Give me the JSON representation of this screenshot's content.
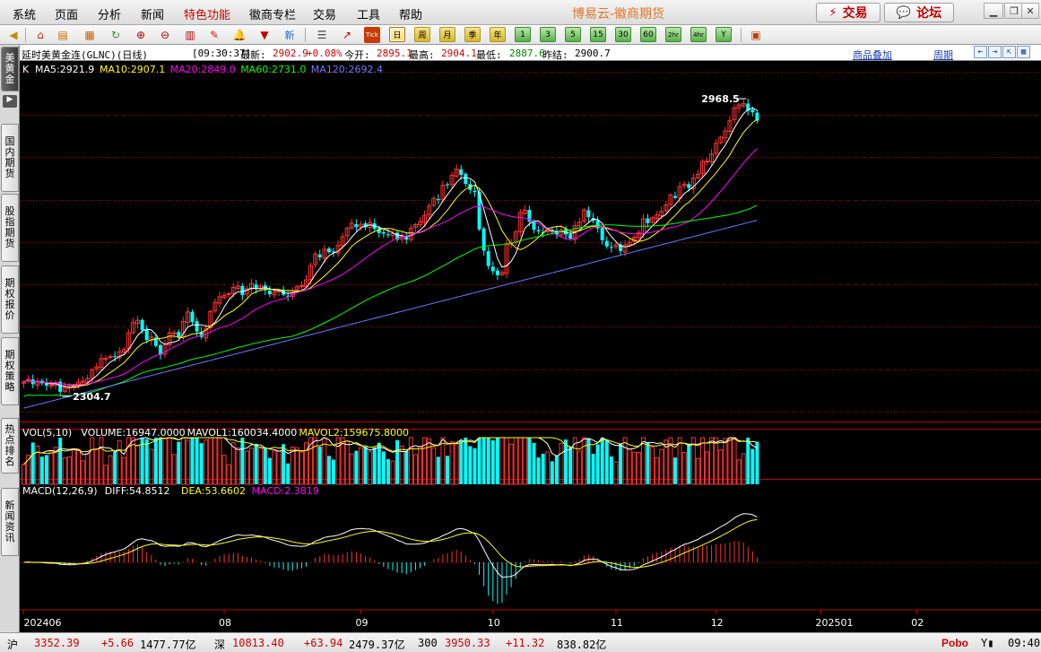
{
  "menu": {
    "items": [
      "系统",
      "页面",
      "分析",
      "新闻",
      "特色功能",
      "徽商专栏",
      "交易",
      "工具",
      "帮助"
    ],
    "app_title": "博易云-徽商期货",
    "trade_button": "交易",
    "forum_button": "论坛"
  },
  "toolbar": {
    "periods": [
      "日",
      "周",
      "月",
      "季",
      "年",
      "1",
      "3",
      "5",
      "15",
      "30",
      "60",
      "2hr",
      "4hr",
      "Y"
    ],
    "active_period": "日"
  },
  "sidebar": {
    "tabs": [
      "美黄金",
      "国内期货",
      "股指期货",
      "期权报价",
      "期权策略",
      "热点排名",
      "新闻资讯"
    ]
  },
  "quote": {
    "time": "[09:30:37]",
    "last_label": "最新:",
    "last": "2902.9",
    "change": "+0.08%",
    "open_label": "今开:",
    "open": "2895.1",
    "high_label": "最高:",
    "high": "2904.1",
    "low_label": "最低:",
    "low": "2887.6",
    "prev_label": "昨结:",
    "prev_close": "2900.7",
    "overlay_link": "商品叠加",
    "cycle_link": "周期"
  },
  "chart_data": {
    "type": "candlestick",
    "title": "延时美黄金连(GLNC)(日线)",
    "price_pane": {
      "indicator_prefix": "K",
      "ma_labels": [
        {
          "text": "MA5:2921.9",
          "color": "#ffffff"
        },
        {
          "text": "MA10:2907.1",
          "color": "#ffff00"
        },
        {
          "text": "MA20:2849.0",
          "color": "#ff00ff"
        },
        {
          "text": "MA60:2731.0",
          "color": "#00ff00"
        },
        {
          "text": "MA120:2692.4",
          "color": "#6b7bff"
        }
      ],
      "high_marker": "2968.5",
      "low_marker": "2304.7",
      "ylim": [
        2240,
        3010
      ],
      "x_ticks": [
        "202406",
        "08",
        "09",
        "10",
        "11",
        "12",
        "202501",
        "02"
      ],
      "x_tick_days": [
        0,
        44,
        74,
        103,
        130,
        152,
        175,
        196
      ],
      "closes": [
        2332.6,
        2338.1,
        2327.5,
        2333.9,
        2329.3,
        2324.2,
        2326.1,
        2330.7,
        2310.8,
        2320.3,
        2319.9,
        2324.1,
        2332.0,
        2334.1,
        2339.8,
        2359.1,
        2365.4,
        2383.5,
        2383.8,
        2387.9,
        2387.3,
        2398.4,
        2403.1,
        2439.6,
        2462.0,
        2467.1,
        2445.8,
        2423.7,
        2430.6,
        2411.2,
        2391.7,
        2414.9,
        2439.7,
        2439.5,
        2430.8,
        2464.5,
        2485.3,
        2462.9,
        2442.5,
        2430.5,
        2449.3,
        2486.1,
        2506.2,
        2518.5,
        2521.2,
        2525.0,
        2538.9,
        2542.1,
        2522.2,
        2535.8,
        2547.2,
        2535.3,
        2541.7,
        2532.8,
        2524.0,
        2528.3,
        2532.6,
        2522.9,
        2519.8,
        2531.9,
        2540.4,
        2542.6,
        2555.3,
        2586.7,
        2611.8,
        2604.4,
        2622.1,
        2616.0,
        2615.7,
        2630.5,
        2649.5,
        2668.4,
        2679.1,
        2671.1,
        2676.7,
        2670.0,
        2680.6,
        2666.8,
        2657.6,
        2656.4,
        2653.3,
        2656.3,
        2643.5,
        2650.9,
        2643.4,
        2668.2,
        2675.9,
        2682.7,
        2696.3,
        2716.3,
        2733.4,
        2731.5,
        2762.1,
        2762.8,
        2784.0,
        2797.3,
        2784.8,
        2765.0,
        2752.0,
        2747.1,
        2665.6,
        2619.1,
        2585.7,
        2574.2,
        2565.4,
        2571.4,
        2632.9,
        2634.9,
        2660.1,
        2702.6,
        2707.8,
        2682.6,
        2665.0,
        2661.4,
        2658.8,
        2662.8,
        2664.1,
        2654.2,
        2664.7,
        2654.4,
        2645.6,
        2673.7,
        2681.7,
        2708.1,
        2692.8,
        2684.1,
        2667.8,
        2642.0,
        2628.4,
        2626.0,
        2632.0,
        2618.4,
        2632.1,
        2637.4,
        2648.0,
        2658.0,
        2688.8,
        2679.5,
        2691.0,
        2697.3,
        2704.8,
        2718.9,
        2740.6,
        2734.6,
        2759.0,
        2764.5,
        2756.2,
        2777.5,
        2785.3,
        2813.8,
        2814.8,
        2830.4,
        2853.7,
        2867.2,
        2880.6,
        2902.9,
        2930.8,
        2937.4,
        2940.2,
        2925.1,
        2921.6,
        2902.9
      ]
    },
    "volume_pane": {
      "labels": [
        {
          "text": "VOL(5,10)",
          "color": "#ffffff"
        },
        {
          "text": "VOLUME:16947.0000",
          "color": "#ffffff"
        },
        {
          "text": "MAVOL1:160034.4000",
          "color": "#ffffff"
        },
        {
          "text": "MAVOL2:159675.8000",
          "color": "#ffff00"
        }
      ]
    },
    "macd_pane": {
      "labels": [
        {
          "text": "MACD(12,26,9)",
          "color": "#ffffff"
        },
        {
          "text": "DIFF:54.8512",
          "color": "#ffffff"
        },
        {
          "text": "DEA:53.6602",
          "color": "#ffff00"
        },
        {
          "text": "MACD:2.3819",
          "color": "#ff00ff"
        }
      ]
    }
  },
  "statusbar": {
    "sh_label": "沪",
    "sh_value": "3352.39",
    "sh_change": "+5.66",
    "sh_amount": "1477.77亿",
    "sz_label": "深",
    "sz_value": "10813.40",
    "sz_change": "+63.94",
    "sz_amount": "2479.37亿",
    "c300_label": "300",
    "c300_value": "3950.33",
    "c300_change": "+11.32",
    "c300_amount": "838.82亿",
    "brand": "Pobo",
    "clock": "09:40"
  },
  "colors": {
    "up": "#ff3232",
    "down": "#00ffff",
    "grid": "#a00000",
    "ma5": "#ffffff",
    "ma10": "#ffff00",
    "ma20": "#ff00ff",
    "ma60": "#00ff00",
    "ma120": "#6b7bff"
  }
}
